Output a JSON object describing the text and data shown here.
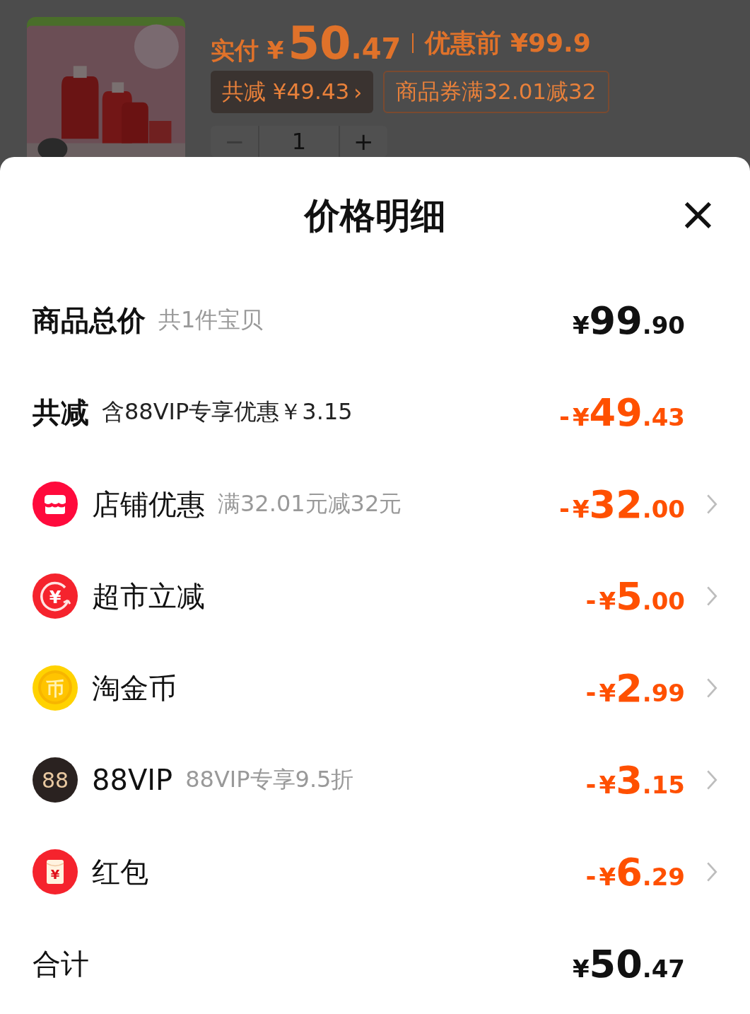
{
  "product": {
    "price": {
      "label": "实付",
      "currency": "¥",
      "integer": "50",
      "decimal": ".47",
      "original": "优惠前 ¥99.9"
    },
    "chips": [
      {
        "kind": "filled",
        "text": "共减 ¥49.43",
        "chevron": "›"
      },
      {
        "kind": "outlined",
        "text": "商品券满32.01减32"
      }
    ],
    "stepper": {
      "minus": "−",
      "value": "1",
      "plus": "+"
    }
  },
  "sheet": {
    "title": "价格明细",
    "close": "×",
    "rows": [
      {
        "kind": "subtotal",
        "label": "商品总价",
        "note": "共1件宝贝",
        "amount": {
          "currency": "¥",
          "integer": "99",
          "decimal": ".90"
        },
        "chevron": false
      },
      {
        "kind": "reduction",
        "label": "共减",
        "note": "含88VIP专享优惠￥3.15",
        "amount": {
          "sign": "-",
          "currency": "¥",
          "integer": "49",
          "decimal": ".43"
        },
        "chevron": false
      },
      {
        "kind": "shop",
        "label": "店铺优惠",
        "note": "满32.01元减32元",
        "amount": {
          "sign": "-",
          "currency": "¥",
          "integer": "32",
          "decimal": ".00"
        },
        "chevron": true
      },
      {
        "kind": "rebate",
        "icon_glyph": "¥",
        "label": "超市立减",
        "amount": {
          "sign": "-",
          "currency": "¥",
          "integer": "5",
          "decimal": ".00"
        },
        "chevron": true
      },
      {
        "kind": "coin",
        "icon_glyph": "币",
        "label": "淘金币",
        "amount": {
          "sign": "-",
          "currency": "¥",
          "integer": "2",
          "decimal": ".99"
        },
        "chevron": true
      },
      {
        "kind": "vip",
        "icon_glyph": "88",
        "label": "88VIP",
        "note": "88VIP专享9.5折",
        "amount": {
          "sign": "-",
          "currency": "¥",
          "integer": "3",
          "decimal": ".15"
        },
        "chevron": true
      },
      {
        "kind": "envelope",
        "icon_glyph": "¥",
        "label": "红包",
        "amount": {
          "sign": "-",
          "currency": "¥",
          "integer": "6",
          "decimal": ".29"
        },
        "chevron": true
      },
      {
        "kind": "total",
        "label": "合计",
        "amount": {
          "currency": "¥",
          "integer": "50",
          "decimal": ".47"
        },
        "chevron": false
      }
    ]
  }
}
